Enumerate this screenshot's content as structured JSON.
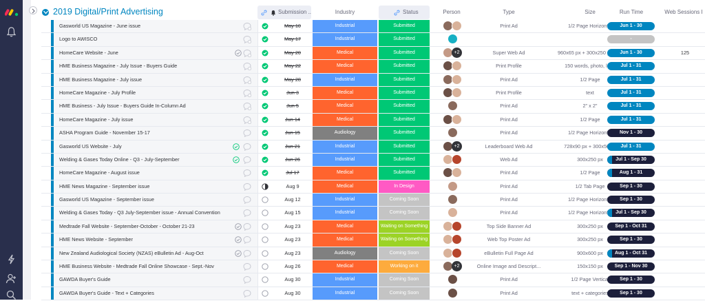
{
  "board": {
    "group_title": "2019 Digital/Print Advertising",
    "group_color": "#0086c0"
  },
  "columns": {
    "submission": "Submission ...",
    "industry": "Industry",
    "status": "Status",
    "person": "Person",
    "type": "Type",
    "size": "Size",
    "run_time": "Run Time",
    "web_sessions": "Web Sessions I"
  },
  "colors": {
    "Industrial": "#579bfc",
    "Medical": "#ff642e",
    "Audiology": "#808080",
    "Submitted": "#00c875",
    "In Design": "#ff5ac4",
    "Coming Soon": "#c4c4c4",
    "Waiting on Something": "#9cd326",
    "Working on it": "#fdab3d"
  },
  "rows": [
    {
      "name": "Gasworld US Magazine - June issue",
      "check": "",
      "subm_state": "done",
      "date": "May 10",
      "industry": "Industrial",
      "status": "Submitted",
      "persons": [
        "#8a6a5c",
        "#d9b29a"
      ],
      "plus": "",
      "type": "Print Ad",
      "size": "1/2 Page Horizontal",
      "run": "Jun 1 - 30",
      "run_style": "blue",
      "ws": ""
    },
    {
      "name": "Logo to AWISCO",
      "check": "",
      "subm_state": "done",
      "date": "May 17",
      "industry": "Industrial",
      "status": "Submitted",
      "persons": [
        "#16b0c4"
      ],
      "plus": "",
      "type": "",
      "size": "",
      "run": "-",
      "run_style": "na",
      "ws": ""
    },
    {
      "name": "HomeCare Website - June",
      "check": "gray",
      "subm_state": "done",
      "date": "May 20",
      "industry": "Medical",
      "status": "Submitted",
      "persons": [
        "#c49a86"
      ],
      "plus": "+2",
      "type": "Super Web Ad",
      "size": "960x65 px + 300x250 px + ...",
      "run": "Jun 1 - 30",
      "run_style": "blue",
      "ws": "125"
    },
    {
      "name": "HME Business Magazine - July Issue - Buyers Guide",
      "check": "",
      "subm_state": "done",
      "date": "May 22",
      "industry": "Medical",
      "status": "Submitted",
      "persons": [
        "#6b5046",
        "#d9b29a"
      ],
      "plus": "",
      "type": "Print Profile",
      "size": "150 words, photo, logo",
      "run": "Jul 1 - 31",
      "run_style": "blue",
      "ws": ""
    },
    {
      "name": "HME Business Magazine - July issue",
      "check": "",
      "subm_state": "done",
      "date": "May 28",
      "industry": "Industrial",
      "status": "Submitted",
      "persons": [
        "#8a6a5c",
        "#d9b29a"
      ],
      "plus": "",
      "type": "Print Ad",
      "size": "1/2 Page",
      "run": "Jul 1 - 31",
      "run_style": "blue",
      "ws": ""
    },
    {
      "name": "HomeCare Magazine - July Profile",
      "check": "",
      "subm_state": "done",
      "date": "Jun 3",
      "industry": "Medical",
      "status": "Submitted",
      "persons": [
        "#6b5046",
        "#d9b29a"
      ],
      "plus": "",
      "type": "Print Profile",
      "size": "text",
      "run": "Jul 1 - 31",
      "run_style": "blue",
      "ws": ""
    },
    {
      "name": "HME Business - July Issue - Buyers Guide In-Column Ad",
      "check": "",
      "subm_state": "done",
      "date": "Jun 5",
      "industry": "Medical",
      "status": "Submitted",
      "persons": [
        "#8a6a5c"
      ],
      "plus": "",
      "type": "Print Ad",
      "size": "2\" x 2\"",
      "run": "Jul 1 - 31",
      "run_style": "blue",
      "ws": ""
    },
    {
      "name": "HomeCare Magazine - July issue",
      "check": "",
      "subm_state": "done",
      "date": "Jun 14",
      "industry": "Medical",
      "status": "Submitted",
      "persons": [
        "#6b5046",
        "#d9b29a"
      ],
      "plus": "",
      "type": "Print Ad",
      "size": "1/2 Page",
      "run": "Jul 1 - 31",
      "run_style": "blue",
      "ws": ""
    },
    {
      "name": "ASHA Program Guide - November 15-17",
      "check": "",
      "subm_state": "done",
      "date": "Jun 15",
      "industry": "Audiology",
      "status": "Submitted",
      "persons": [
        "#8a6a5c"
      ],
      "plus": "",
      "type": "Print Ad",
      "size": "1/2 Page Horizontal",
      "run": "Nov 1 - 30",
      "run_style": "dark",
      "ws": ""
    },
    {
      "name": "Gasworld US Website - July",
      "check": "green",
      "subm_state": "done",
      "date": "Jun 21",
      "industry": "Industrial",
      "status": "Submitted",
      "persons": [
        "#6b5046"
      ],
      "plus": "+2",
      "type": "Leaderboard Web Ad",
      "size": "728x90 px + 300x50 px",
      "run": "Jul 1 - 31",
      "run_style": "blue",
      "ws": ""
    },
    {
      "name": "Welding & Gases Today Online - Q3 - July-September",
      "check": "green",
      "subm_state": "done",
      "date": "Jun 26",
      "industry": "Industrial",
      "status": "Submitted",
      "persons": [
        "#d9b29a",
        "#b6452c"
      ],
      "plus": "",
      "type": "Web Ad",
      "size": "300x250 px",
      "run": "Jul 1 - Sep 30",
      "run_style": "dark-acc",
      "ws": ""
    },
    {
      "name": "HomeCare Magazine - August issue",
      "check": "",
      "subm_state": "done",
      "date": "Jul 17",
      "industry": "Medical",
      "status": "Submitted",
      "persons": [
        "#6b5046",
        "#d9b29a"
      ],
      "plus": "",
      "type": "Print Ad",
      "size": "1/2 Page",
      "run": "Aug 1 - 31",
      "run_style": "dark-acc",
      "ws": ""
    },
    {
      "name": "HME News Magazine - September issue",
      "check": "",
      "subm_state": "half",
      "date": "Aug 9",
      "industry": "Medical",
      "status": "In Design",
      "persons": [
        "#c49a86"
      ],
      "plus": "",
      "type": "Print Ad",
      "size": "1/2 Tab Page",
      "run": "Sep 1 - 30",
      "run_style": "dark",
      "ws": ""
    },
    {
      "name": "Gasworld US Magazine - September issue",
      "check": "",
      "subm_state": "empty",
      "date": "Aug 12",
      "industry": "Industrial",
      "status": "Coming Soon",
      "persons": [
        "#8a6a5c"
      ],
      "plus": "",
      "type": "Print Ad",
      "size": "1/2 Page Horizontal",
      "run": "Sep 1 - 30",
      "run_style": "dark",
      "ws": ""
    },
    {
      "name": "Welding & Gases Today - Q3 July-September issue - Annual Convention",
      "check": "",
      "subm_state": "empty",
      "date": "Aug 15",
      "industry": "Industrial",
      "status": "Coming Soon",
      "persons": [
        "#d9b29a"
      ],
      "plus": "",
      "type": "Print Ad",
      "size": "1/2 Page Horizontal",
      "run": "Jul 1 - Sep 30",
      "run_style": "dark-acc",
      "ws": ""
    },
    {
      "name": "Medtrade Fall Website - September-October - October 21-23",
      "check": "gray",
      "subm_state": "empty",
      "date": "Aug 23",
      "industry": "Medical",
      "status": "Waiting on Something",
      "persons": [
        "#d9b29a",
        "#b6452c"
      ],
      "plus": "",
      "type": "Top Side Banner Ad",
      "size": "300x250 px",
      "run": "Sep 1 - Oct 31",
      "run_style": "dark",
      "ws": ""
    },
    {
      "name": "HME News Website - September",
      "check": "gray",
      "subm_state": "empty",
      "date": "Aug 23",
      "industry": "Medical",
      "status": "Waiting on Something",
      "persons": [
        "#d9b29a",
        "#b6452c"
      ],
      "plus": "",
      "type": "Web Top Poster Ad",
      "size": "300x250 px",
      "run": "Sep 1 - 30",
      "run_style": "dark",
      "ws": ""
    },
    {
      "name": "New Zealand Audiological Society (NZAS) eBulletin Ad - Aug-Oct",
      "check": "gray",
      "subm_state": "empty",
      "date": "Aug 23",
      "industry": "Audiology",
      "status": "Coming Soon",
      "persons": [
        "#d9b29a",
        "#b6452c"
      ],
      "plus": "",
      "type": "eBulletin Full Page Ad",
      "size": "900x600 px",
      "run": "Aug 1 - Oct 31",
      "run_style": "dark-acc",
      "ws": ""
    },
    {
      "name": "HME Business Website - Medtrade Fall Online Showcase - Sept.-Nov",
      "check": "",
      "subm_state": "empty",
      "date": "Aug 26",
      "industry": "Medical",
      "status": "Working on it",
      "persons": [
        "#8a6a5c"
      ],
      "plus": "+2",
      "type": "Online Image and Descript...",
      "size": "150x150 px",
      "run": "Sep 1 - Nov 30",
      "run_style": "dark",
      "ws": ""
    },
    {
      "name": "GAWDA Buyer's Guide",
      "check": "",
      "subm_state": "empty",
      "date": "Aug 30",
      "industry": "Industrial",
      "status": "Coming Soon",
      "persons": [
        "#6b5046"
      ],
      "plus": "",
      "type": "Print Ad",
      "size": "1/2 Page Vertical",
      "run": "Sep 1 - 30",
      "run_style": "dark",
      "ws": ""
    },
    {
      "name": "GAWDA Buyer's Guide - Text + Categories",
      "check": "",
      "subm_state": "empty",
      "date": "Aug 30",
      "industry": "Industrial",
      "status": "Coming Soon",
      "persons": [
        "#6b5046"
      ],
      "plus": "",
      "type": "Print Ad",
      "size": "text + categories",
      "run": "Sep 1 - 30",
      "run_style": "dark",
      "ws": ""
    }
  ]
}
